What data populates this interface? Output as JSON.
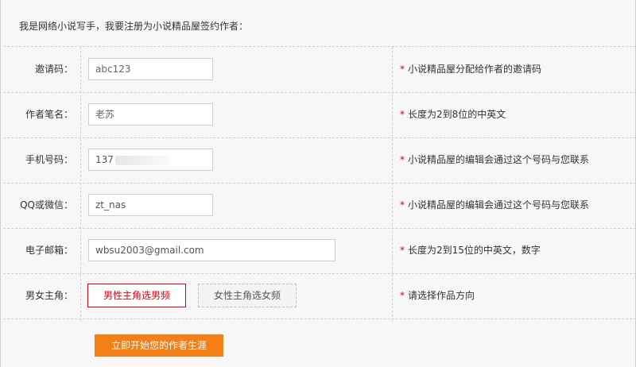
{
  "intro_text": "我是网络小说写手，我要注册为小说精品屋签约作者：",
  "fields": {
    "invite_code": {
      "label": "邀请码：",
      "value": "abc123",
      "hint": "小说精品屋分配给作者的邀请码"
    },
    "pen_name": {
      "label": "作者笔名：",
      "value": "老苏",
      "hint": "长度为2到8位的中英文"
    },
    "phone": {
      "label": "手机号码：",
      "value": "137",
      "hint": "小说精品屋的编辑会通过这个号码与您联系"
    },
    "qq_wechat": {
      "label": "QQ或微信：",
      "value": "zt_nas",
      "hint": "小说精品屋的编辑会通过这个号码与您联系"
    },
    "email": {
      "label": "电子邮箱：",
      "value": "wbsu2003@gmail.com",
      "hint": "长度为2到15位的中英文，数字"
    },
    "protagonist": {
      "label": "男女主角：",
      "options": [
        "男性主角选男频",
        "女性主角选女频"
      ],
      "selected": "男性主角选男频",
      "hint": "请选择作品方向"
    }
  },
  "required_mark": "*",
  "submit_label": "立即开始您的作者生涯",
  "colors": {
    "accent": "#f57f17",
    "required": "#d9000b",
    "selected_border": "#d7000f"
  }
}
